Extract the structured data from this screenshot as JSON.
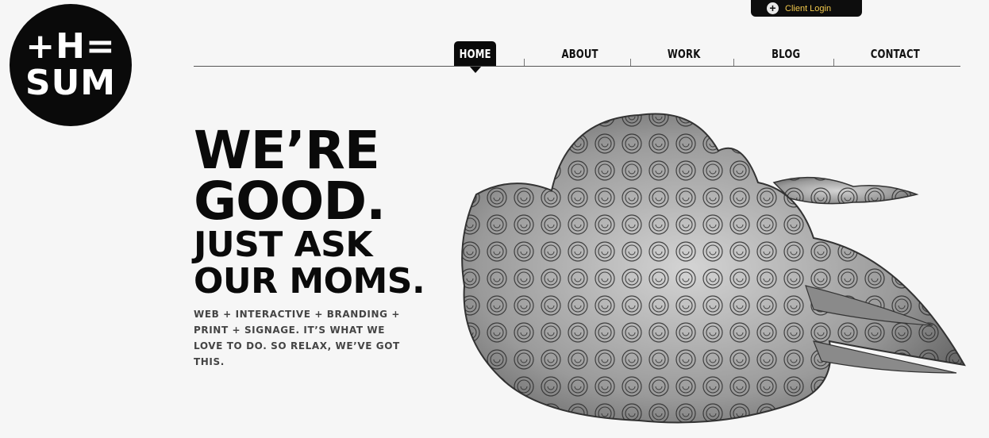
{
  "logo": {
    "line1": "+H=",
    "line2": "SUM"
  },
  "client_login": {
    "label": "Client Login",
    "icon": "plus-circle-icon"
  },
  "nav": {
    "items": [
      {
        "label": "HOME",
        "active": true
      },
      {
        "label": "ABOUT",
        "active": false
      },
      {
        "label": "WORK",
        "active": false
      },
      {
        "label": "BLOG",
        "active": false
      },
      {
        "label": "CONTACT",
        "active": false
      }
    ]
  },
  "hero": {
    "line1": "WE’RE",
    "line2": "GOOD.",
    "line3": "JUST ASK",
    "line4": "OUR MOMS.",
    "tagline": "WEB + INTERACTIVE + BRANDING + PRINT + SIGNAGE. IT’S WHAT WE LOVE TO DO. SO RELAX, WE’VE GOT THIS."
  },
  "colors": {
    "accent_gold": "#f2c94c",
    "dark": "#0a0a0a",
    "background": "#f6f6f6"
  }
}
